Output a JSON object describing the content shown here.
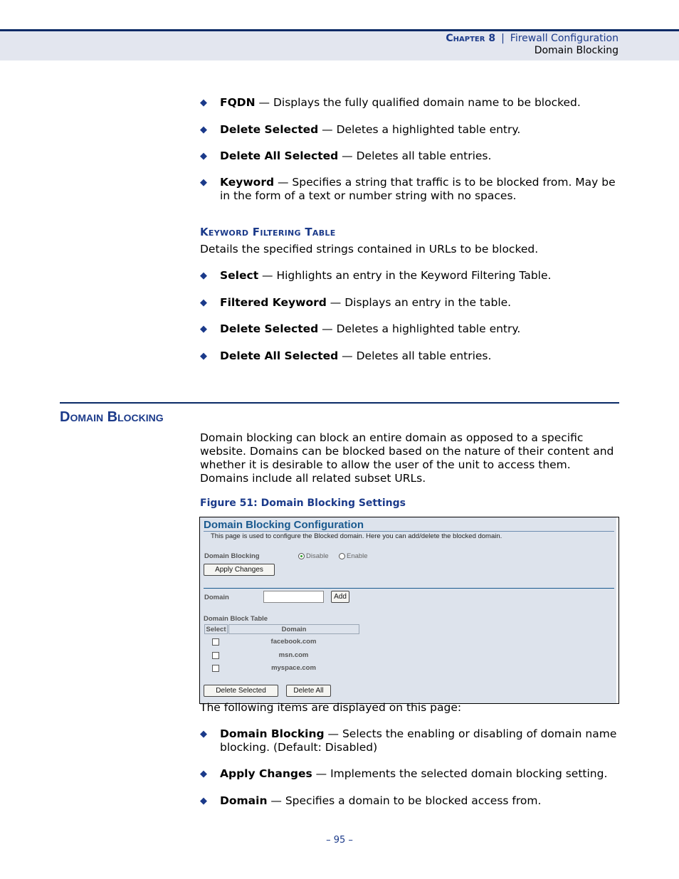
{
  "header": {
    "chapter": "Chapter 8",
    "separator": "|",
    "chapter_title": "Firewall Configuration",
    "section": "Domain Blocking"
  },
  "bullets_top": [
    {
      "term": "FQDN",
      "desc": " — Displays the fully qualified domain name to be blocked."
    },
    {
      "term": "Delete Selected",
      "desc": " — Deletes a highlighted table entry."
    },
    {
      "term": "Delete All Selected",
      "desc": " — Deletes all table entries."
    },
    {
      "term": "Keyword",
      "desc": " — Specifies a string that traffic is to be blocked from. May be in the form of a text or number string with no spaces."
    }
  ],
  "keyword_section": {
    "heading": "Keyword Filtering Table",
    "intro": "Details the specified strings contained in URLs to be blocked.",
    "bullets": [
      {
        "term": "Select",
        "desc": " — Highlights an entry in the Keyword Filtering Table."
      },
      {
        "term": "Filtered Keyword",
        "desc": " — Displays an entry in the table."
      },
      {
        "term": "Delete Selected",
        "desc": " — Deletes a highlighted table entry."
      },
      {
        "term": "Delete All Selected",
        "desc": " — Deletes all table entries."
      }
    ]
  },
  "domain_section": {
    "heading": "Domain Blocking",
    "intro": "Domain blocking can block an entire domain as opposed to a specific website. Domains can be blocked based on the nature of their content and whether it is desirable to allow the user of the unit to access them. Domains include all related subset URLs.",
    "figure_caption": "Figure 51:  Domain Blocking Settings",
    "after_figure": "The following items are displayed on this page:",
    "bullets": [
      {
        "term": "Domain Blocking",
        "desc": " — Selects the enabling or disabling of domain name blocking. (Default: Disabled)"
      },
      {
        "term": "Apply Changes",
        "desc": " — Implements the selected domain blocking setting."
      },
      {
        "term": "Domain",
        "desc": " — Specifies a domain to be blocked access from."
      }
    ]
  },
  "figure": {
    "title": "Domain Blocking Configuration",
    "description": "This page is used to configure the Blocked domain. Here you can add/delete the blocked domain.",
    "domain_blocking_label": "Domain Blocking",
    "radio_disable": "Disable",
    "radio_enable": "Enable",
    "selected_option": "Disable",
    "apply_button": "Apply Changes",
    "domain_label": "Domain",
    "domain_input_value": "",
    "add_button": "Add",
    "table_title": "Domain Block Table",
    "table_headers": [
      "Select",
      "Domain"
    ],
    "rows": [
      {
        "domain": "facebook.com",
        "checked": false
      },
      {
        "domain": "msn.com",
        "checked": false
      },
      {
        "domain": "myspace.com",
        "checked": false
      }
    ],
    "delete_selected_button": "Delete Selected",
    "delete_all_button": "Delete All"
  },
  "page_number": "–  95  –",
  "colors": {
    "accent": "#1b3a8a",
    "header_band": "#e3e6ef",
    "figure_bg": "#dde3ec",
    "figure_title": "#1a5a8f"
  }
}
